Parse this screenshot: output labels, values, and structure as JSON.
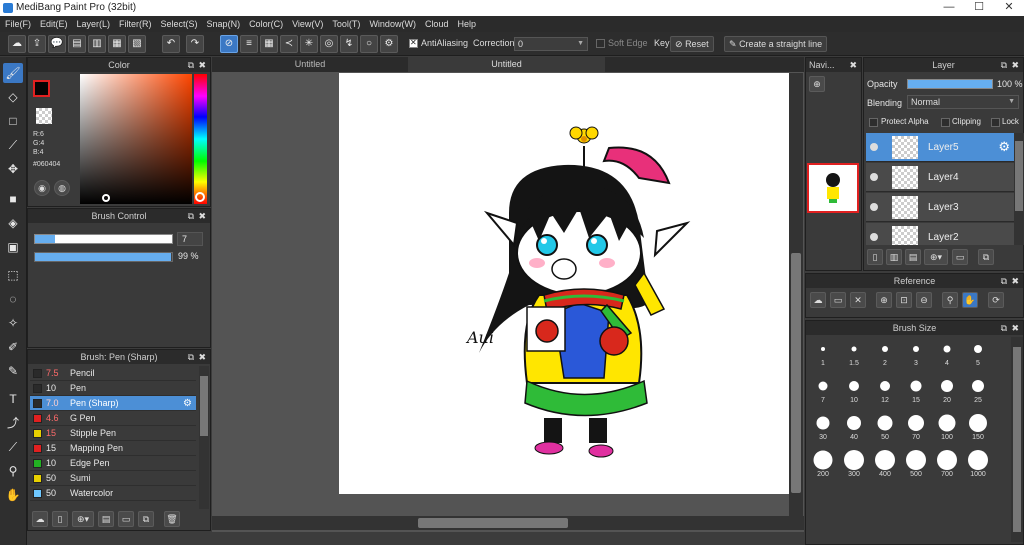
{
  "window": {
    "title": "MediBang Paint Pro (32bit)"
  },
  "menu": [
    "File(F)",
    "Edit(E)",
    "Layer(L)",
    "Filter(R)",
    "Select(S)",
    "Snap(N)",
    "Color(C)",
    "View(V)",
    "Tool(T)",
    "Window(W)",
    "Cloud",
    "Help"
  ],
  "toolbar": {
    "antialiasing_label": "AntiAliasing",
    "correction_label": "Correction",
    "correction_value": "0",
    "soft_edge_label": "Soft Edge",
    "key_label": "Key",
    "reset_label": "Reset",
    "straight_line_label": "Create a straight line"
  },
  "color_panel": {
    "title": "Color",
    "primary_color": "#060404",
    "r_label": "R:6",
    "g_label": "G:4",
    "b_label": "B:4",
    "hex_label": "#060404"
  },
  "brush_control": {
    "title": "Brush Control",
    "size_value": "7",
    "size_fraction": 0.07,
    "opacity_value": "99 %",
    "opacity_fraction": 0.99
  },
  "brush_panel": {
    "title": "Brush: Pen (Sharp)",
    "items": [
      {
        "size": "7.5",
        "name": "Pencil",
        "color": "#2a2a2a",
        "size_color": "#ff6b6b"
      },
      {
        "size": "10",
        "name": "Pen",
        "color": "#2a2a2a",
        "size_color": "#e8e8e8"
      },
      {
        "size": "7.0",
        "name": "Pen (Sharp)",
        "color": "#2a2a2a",
        "size_color": "#ff6b6b"
      },
      {
        "size": "4.6",
        "name": "G Pen",
        "color": "#e02020",
        "size_color": "#ff6b6b"
      },
      {
        "size": "15",
        "name": "Stipple Pen",
        "color": "#e8d000",
        "size_color": "#ff6b6b"
      },
      {
        "size": "15",
        "name": "Mapping Pen",
        "color": "#e02020",
        "size_color": "#e8e8e8"
      },
      {
        "size": "10",
        "name": "Edge Pen",
        "color": "#22b022",
        "size_color": "#e8e8e8"
      },
      {
        "size": "50",
        "name": "Sumi",
        "color": "#e8d000",
        "size_color": "#e8e8e8"
      },
      {
        "size": "50",
        "name": "Watercolor",
        "color": "#6fc8ff",
        "size_color": "#e8e8e8"
      }
    ]
  },
  "canvas": {
    "tab1": "Untitled",
    "tab2": "Untitled",
    "signature": "Aui"
  },
  "navigator": {
    "title": "Navi..."
  },
  "layer_panel": {
    "title": "Layer",
    "opacity_label": "Opacity",
    "opacity_value": "100 %",
    "blending_label": "Blending",
    "blending_value": "Normal",
    "protect_alpha_label": "Protect Alpha",
    "clipping_label": "Clipping",
    "lock_label": "Lock",
    "layers": [
      "Layer5",
      "Layer4",
      "Layer3",
      "Layer2"
    ]
  },
  "reference_panel": {
    "title": "Reference"
  },
  "brush_size_panel": {
    "title": "Brush Size",
    "sizes": [
      "1",
      "1.5",
      "2",
      "3",
      "4",
      "5",
      "7",
      "10",
      "12",
      "15",
      "20",
      "25",
      "30",
      "40",
      "50",
      "70",
      "100",
      "150",
      "200",
      "300",
      "400",
      "500",
      "700",
      "1000"
    ]
  }
}
